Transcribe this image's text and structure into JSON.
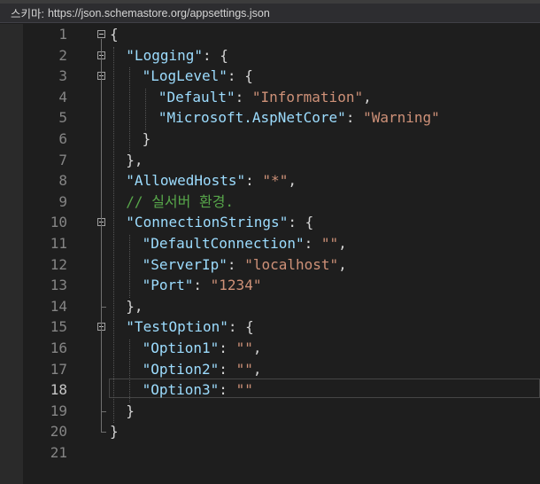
{
  "schema_bar": {
    "label": "스키마:",
    "url": "https://json.schemastore.org/appsettings.json"
  },
  "editor": {
    "current_line": 18,
    "lines": [
      {
        "n": "1",
        "tokens": [
          {
            "t": "{",
            "c": "p"
          }
        ]
      },
      {
        "n": "2",
        "tokens": [
          {
            "t": "\"Logging\"",
            "c": "k"
          },
          {
            "t": ": {",
            "c": "p"
          }
        ]
      },
      {
        "n": "3",
        "tokens": [
          {
            "t": "\"LogLevel\"",
            "c": "k"
          },
          {
            "t": ": {",
            "c": "p"
          }
        ]
      },
      {
        "n": "4",
        "tokens": [
          {
            "t": "\"Default\"",
            "c": "k"
          },
          {
            "t": ": ",
            "c": "p"
          },
          {
            "t": "\"Information\"",
            "c": "s"
          },
          {
            "t": ",",
            "c": "p"
          }
        ]
      },
      {
        "n": "5",
        "tokens": [
          {
            "t": "\"Microsoft.AspNetCore\"",
            "c": "k"
          },
          {
            "t": ": ",
            "c": "p"
          },
          {
            "t": "\"Warning\"",
            "c": "s"
          }
        ]
      },
      {
        "n": "6",
        "tokens": [
          {
            "t": "}",
            "c": "p"
          }
        ]
      },
      {
        "n": "7",
        "tokens": [
          {
            "t": "},",
            "c": "p"
          }
        ]
      },
      {
        "n": "8",
        "tokens": [
          {
            "t": "\"AllowedHosts\"",
            "c": "k"
          },
          {
            "t": ": ",
            "c": "p"
          },
          {
            "t": "\"*\"",
            "c": "s"
          },
          {
            "t": ",",
            "c": "p"
          }
        ]
      },
      {
        "n": "9",
        "tokens": [
          {
            "t": "// 실서버 환경.",
            "c": "c"
          }
        ]
      },
      {
        "n": "10",
        "tokens": [
          {
            "t": "\"ConnectionStrings\"",
            "c": "k"
          },
          {
            "t": ": {",
            "c": "p"
          }
        ]
      },
      {
        "n": "11",
        "tokens": [
          {
            "t": "\"DefaultConnection\"",
            "c": "k"
          },
          {
            "t": ": ",
            "c": "p"
          },
          {
            "t": "\"\"",
            "c": "s"
          },
          {
            "t": ",",
            "c": "p"
          }
        ]
      },
      {
        "n": "12",
        "tokens": [
          {
            "t": "\"ServerIp\"",
            "c": "k"
          },
          {
            "t": ": ",
            "c": "p"
          },
          {
            "t": "\"localhost\"",
            "c": "s"
          },
          {
            "t": ",",
            "c": "p"
          }
        ]
      },
      {
        "n": "13",
        "tokens": [
          {
            "t": "\"Port\"",
            "c": "k"
          },
          {
            "t": ": ",
            "c": "p"
          },
          {
            "t": "\"1234\"",
            "c": "s"
          }
        ]
      },
      {
        "n": "14",
        "tokens": [
          {
            "t": "},",
            "c": "p"
          }
        ]
      },
      {
        "n": "15",
        "tokens": [
          {
            "t": "\"TestOption\"",
            "c": "k"
          },
          {
            "t": ": {",
            "c": "p"
          }
        ]
      },
      {
        "n": "16",
        "tokens": [
          {
            "t": "\"Option1\"",
            "c": "k"
          },
          {
            "t": ": ",
            "c": "p"
          },
          {
            "t": "\"\"",
            "c": "s"
          },
          {
            "t": ",",
            "c": "p"
          }
        ]
      },
      {
        "n": "17",
        "tokens": [
          {
            "t": "\"Option2\"",
            "c": "k"
          },
          {
            "t": ": ",
            "c": "p"
          },
          {
            "t": "\"\"",
            "c": "s"
          },
          {
            "t": ",",
            "c": "p"
          }
        ]
      },
      {
        "n": "18",
        "tokens": [
          {
            "t": "\"Option3\"",
            "c": "k"
          },
          {
            "t": ": ",
            "c": "p"
          },
          {
            "t": "\"\"",
            "c": "s"
          }
        ]
      },
      {
        "n": "19",
        "tokens": [
          {
            "t": "}",
            "c": "p"
          }
        ]
      },
      {
        "n": "20",
        "tokens": [
          {
            "t": "}",
            "c": "p"
          }
        ]
      },
      {
        "n": "21",
        "tokens": []
      }
    ]
  },
  "colors": {
    "background": "#1e1e1e",
    "property_key": "#9cdcfe",
    "string_value": "#ce9178",
    "punctuation": "#d4d4d4",
    "comment": "#57a64a",
    "line_number": "#858585"
  }
}
